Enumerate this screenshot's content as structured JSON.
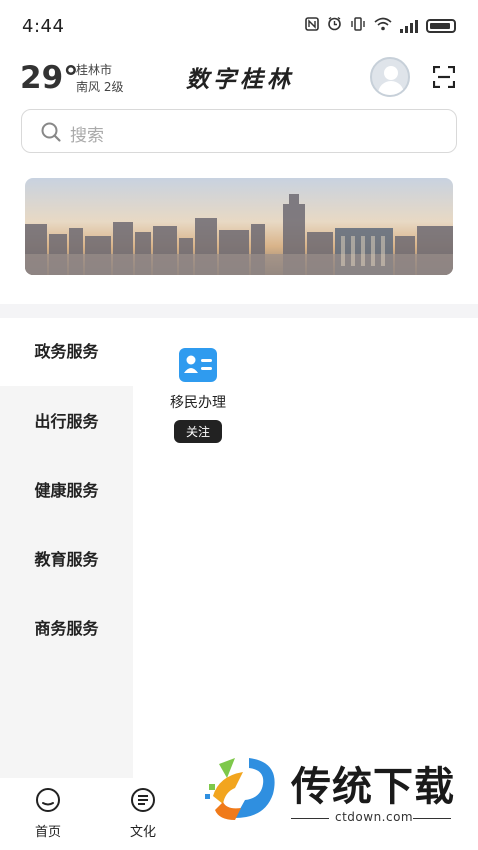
{
  "status_bar": {
    "time": "4:44",
    "icons": [
      "nfc-icon",
      "alarm-icon",
      "vibrate-icon",
      "wifi-icon",
      "signal-icon",
      "battery-icon"
    ]
  },
  "header": {
    "temperature": "29°",
    "city": "桂林市",
    "wind": "南风  2级",
    "title": "数字桂林"
  },
  "search": {
    "placeholder": "搜索"
  },
  "categories": [
    {
      "label": "政务服务",
      "active": true
    },
    {
      "label": "出行服务",
      "active": false
    },
    {
      "label": "健康服务",
      "active": false
    },
    {
      "label": "教育服务",
      "active": false
    },
    {
      "label": "商务服务",
      "active": false
    }
  ],
  "services": [
    {
      "label": "移民办理",
      "badge": "关注",
      "icon": "id-card-icon"
    }
  ],
  "bottom_nav": [
    {
      "label": "首页",
      "icon": "home-icon"
    },
    {
      "label": "文化",
      "icon": "document-icon"
    }
  ],
  "watermark": {
    "title": "传统下载",
    "site": "ctdown.com"
  },
  "colors": {
    "accent": "#2f9bef",
    "badge": "#222222",
    "sidebar_bg": "#f5f5f5"
  }
}
